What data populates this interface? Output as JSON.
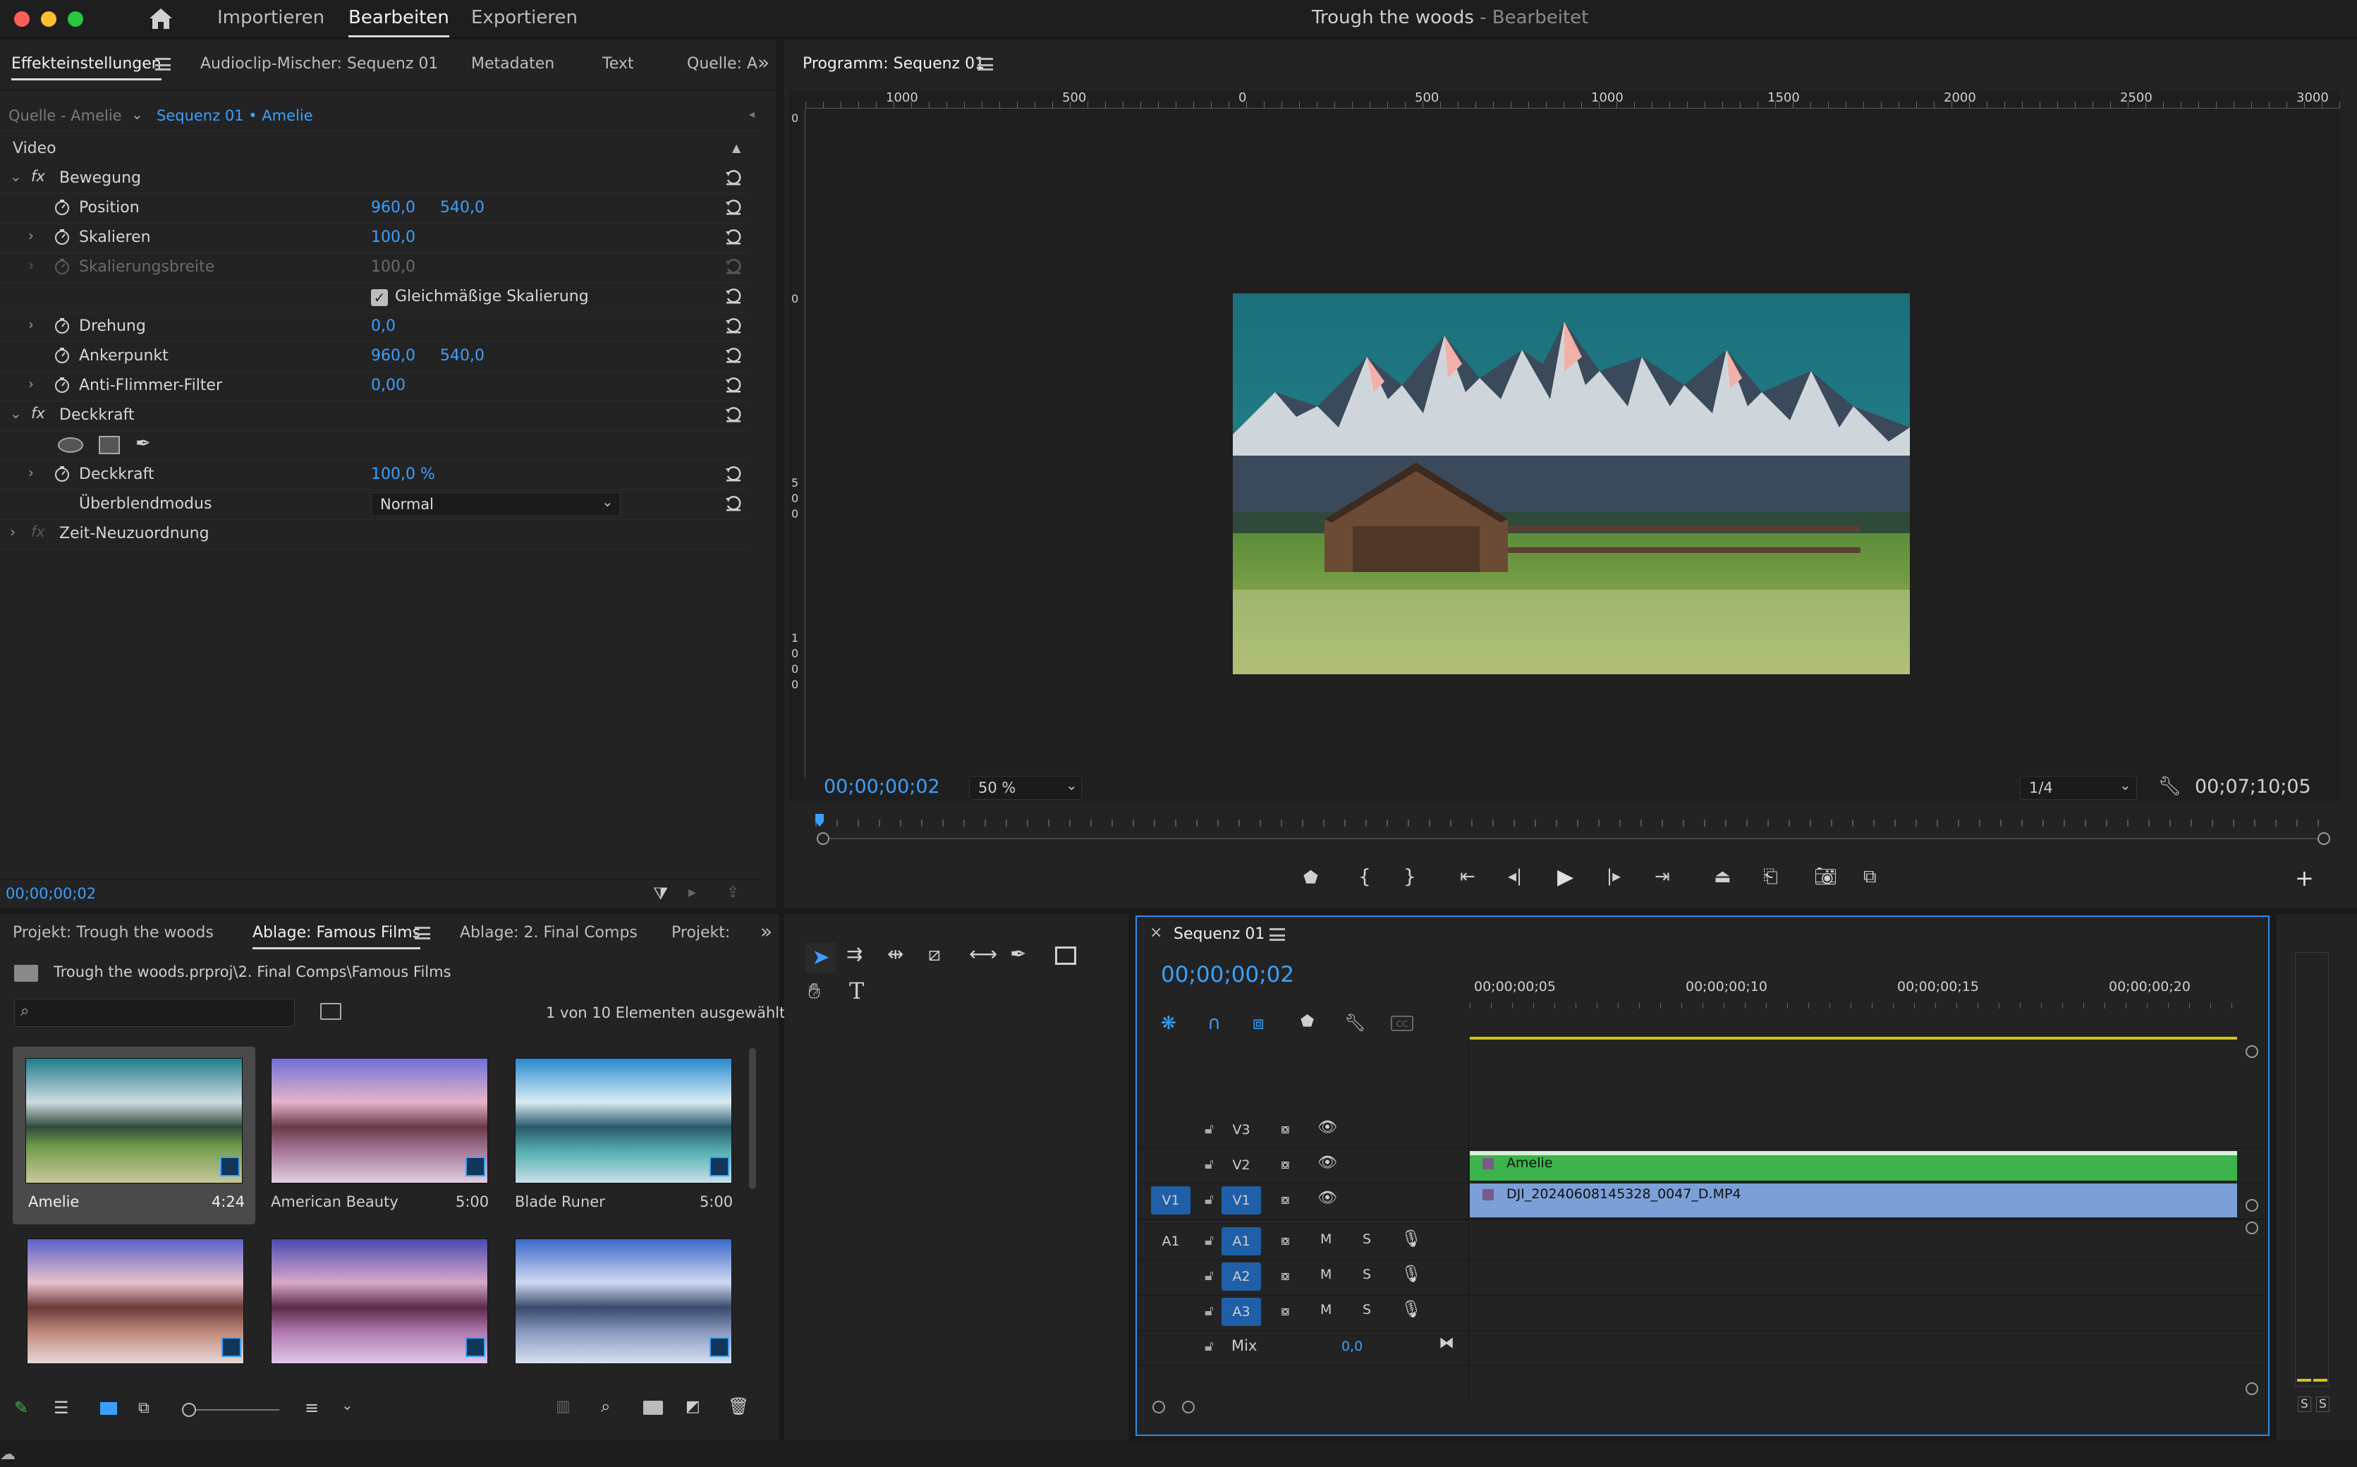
{
  "window": {
    "title": "Trough the woods",
    "status": "- Bearbeitet"
  },
  "workspaces": {
    "import": "Importieren",
    "edit": "Bearbeiten",
    "export": "Exportieren"
  },
  "effects_panel": {
    "tabs": [
      "Effekteinstellungen",
      "Audioclip-Mischer: Sequenz 01",
      "Metadaten",
      "Text",
      "Quelle: A"
    ],
    "source_label": "Quelle - Amelie",
    "sequence_label": "Sequenz 01 • Amelie",
    "section_video": "Video",
    "motion": "Bewegung",
    "position": {
      "label": "Position",
      "x": "960,0",
      "y": "540,0"
    },
    "scale": {
      "label": "Skalieren",
      "value": "100,0"
    },
    "scale_width": {
      "label": "Skalierungsbreite",
      "value": "100,0"
    },
    "uniform_scale": "Gleichmäßige Skalierung",
    "rotation": {
      "label": "Drehung",
      "value": "0,0"
    },
    "anchor": {
      "label": "Ankerpunkt",
      "x": "960,0",
      "y": "540,0"
    },
    "flicker": {
      "label": "Anti-Flimmer-Filter",
      "value": "0,00"
    },
    "opacity_group": "Deckkraft",
    "opacity": {
      "label": "Deckkraft",
      "value": "100,0 %"
    },
    "blend": {
      "label": "Überblendmodus",
      "value": "Normal"
    },
    "time_remap": "Zeit-Neuzuordnung",
    "timecode": "00;00;00;02"
  },
  "program_monitor": {
    "title": "Programm: Sequenz 01",
    "ruler_h": [
      "1000",
      "500",
      "0",
      "500",
      "1000",
      "1500",
      "2000",
      "2500",
      "3000"
    ],
    "ruler_v": [
      "0",
      "0",
      "5\n0\n0",
      "1\n0\n0\n0"
    ],
    "timecode": "00;00;00;02",
    "zoom": "50 %",
    "resolution": "1/4",
    "duration": "00;07;10;05"
  },
  "project_panel": {
    "tabs": [
      "Projekt: Trough the woods",
      "Ablage: Famous Films",
      "Ablage: 2. Final Comps",
      "Projekt:"
    ],
    "path": "Trough the woods.prproj\\2. Final Comps\\Famous Films",
    "selection": "1 von 10 Elementen ausgewählt",
    "items": [
      {
        "name": "Amelie",
        "duration": "4:24"
      },
      {
        "name": "American Beauty",
        "duration": "5:00"
      },
      {
        "name": "Blade Runer",
        "duration": "5:00"
      },
      {
        "name": "",
        "duration": ""
      },
      {
        "name": "",
        "duration": ""
      },
      {
        "name": "",
        "duration": ""
      }
    ]
  },
  "timeline": {
    "title": "Sequenz 01",
    "timecode": "00;00;00;02",
    "ruler": [
      "00;00;00;05",
      "00;00;00;10",
      "00;00;00;15",
      "00;00;00;20"
    ],
    "video_tracks": [
      "V3",
      "V2",
      "V1"
    ],
    "audio_tracks": [
      "A1",
      "A2",
      "A3"
    ],
    "source_v": "V1",
    "source_a": "A1",
    "mix_label": "Mix",
    "mix_value": "0,0",
    "m_label": "M",
    "s_label": "S",
    "clips": [
      {
        "name": "Amelie",
        "track": "V2",
        "color": "#3cb44b"
      },
      {
        "name": "DJI_20240608145328_0047_D.MP4",
        "track": "V1",
        "color": "#7b9fd6"
      }
    ]
  },
  "audio_meter": {
    "labels": [
      "S",
      "S"
    ]
  },
  "colors": {
    "accent": "#3aa0ff",
    "green_clip": "#3cb44b",
    "blue_clip": "#7b9fd6",
    "playhead": "#d4c21c"
  }
}
